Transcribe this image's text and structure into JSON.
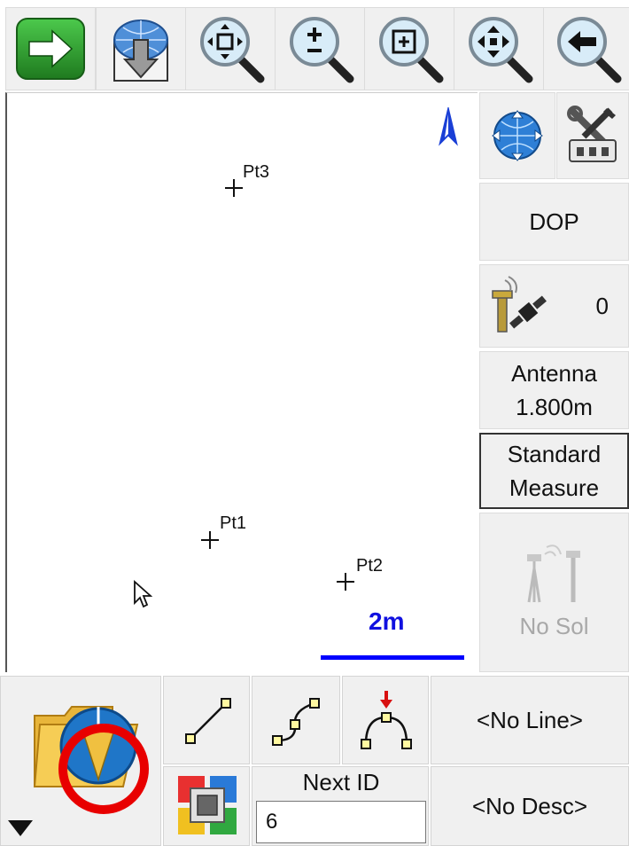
{
  "toolbar": {
    "buttons": [
      {
        "name": "forward-icon"
      },
      {
        "name": "download-globe-icon"
      },
      {
        "name": "zoom-extents-icon"
      },
      {
        "name": "zoom-in-out-icon"
      },
      {
        "name": "zoom-window-icon"
      },
      {
        "name": "pan-icon"
      },
      {
        "name": "back-icon"
      }
    ]
  },
  "map": {
    "points": [
      {
        "label": "Pt3"
      },
      {
        "label": "Pt1"
      },
      {
        "label": "Pt2"
      }
    ],
    "scale_label": "2m",
    "colors": {
      "scale": "#0000ff",
      "north": "#1a3fd6"
    }
  },
  "side": {
    "dop_label": "DOP",
    "satellite_count": "0",
    "antenna_label": "Antenna",
    "antenna_value": "1.800m",
    "measure_line1": "Standard",
    "measure_line2": "Measure",
    "solution_label": "No Sol"
  },
  "bottom": {
    "line_label": "<No Line>",
    "desc_label": "<No Desc>",
    "next_id_label": "Next ID",
    "next_id_value": "6"
  }
}
